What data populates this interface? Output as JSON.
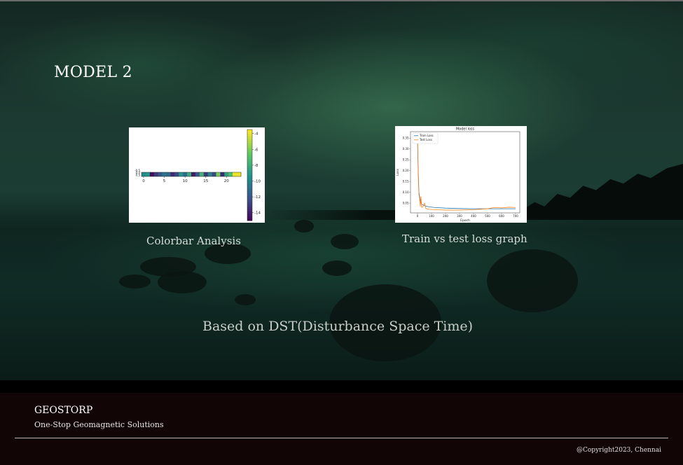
{
  "page": {
    "title": "MODEL 2",
    "subtitle": "Based on DST(Disturbance Space Time)"
  },
  "figures": {
    "left_caption": "Colorbar Analysis",
    "right_caption": "Train vs test loss graph"
  },
  "footer": {
    "brand": "GEOSTORP",
    "tagline": "One-Stop Geomagnetic Solutions",
    "copyright": "@Copyright2023, Chennai"
  },
  "colors": {
    "footer_bg": "#120506",
    "train_line": "#1f77b4",
    "test_line": "#ff7f0e"
  },
  "chart_data": [
    {
      "type": "heatmap",
      "title": "",
      "x_ticks": [
        "0",
        "5",
        "10",
        "15",
        "20"
      ],
      "y_ticks": [
        "-0.5",
        "0.0",
        "0.5"
      ],
      "colorbar_ticks": [
        "-4",
        "-6",
        "-8",
        "-10",
        "-12",
        "-14"
      ],
      "colorbar_range": [
        -15,
        -3.5
      ],
      "values": [
        -9.5,
        -9,
        -14.5,
        -13,
        -12,
        -10.5,
        -11,
        -13.5,
        -12.5,
        -9,
        -11,
        -8,
        -14,
        -12,
        -7.5,
        -13,
        -10,
        -12.5,
        -6,
        -13.5,
        -8.5,
        -7,
        -3.8,
        -3.8
      ],
      "colormap": "viridis"
    },
    {
      "type": "line",
      "title": "Model loss",
      "xlabel": "Epoch",
      "ylabel": "Loss",
      "x_ticks": [
        "0",
        "100",
        "200",
        "300",
        "400",
        "500",
        "600",
        "700"
      ],
      "y_ticks": [
        "0.05",
        "0.10",
        "0.15",
        "0.20",
        "0.25",
        "0.30",
        "0.35"
      ],
      "xlim": [
        -50,
        730
      ],
      "ylim": [
        0.005,
        0.38
      ],
      "legend": "top-left",
      "series": [
        {
          "name": "Train Loss",
          "x": [
            0,
            5,
            10,
            20,
            30,
            50,
            80,
            120,
            200,
            300,
            400,
            500,
            600,
            700
          ],
          "y": [
            0.35,
            0.2,
            0.1,
            0.06,
            0.045,
            0.038,
            0.033,
            0.03,
            0.027,
            0.025,
            0.024,
            0.024,
            0.024,
            0.024
          ]
        },
        {
          "name": "Test Loss",
          "x": [
            0,
            5,
            10,
            15,
            20,
            25,
            30,
            40,
            50,
            60,
            80,
            120,
            200,
            300,
            400,
            450,
            500,
            550,
            600,
            650,
            700
          ],
          "y": [
            0.35,
            0.18,
            0.09,
            0.07,
            0.035,
            0.08,
            0.03,
            0.035,
            0.05,
            0.025,
            0.022,
            0.02,
            0.018,
            0.018,
            0.02,
            0.022,
            0.024,
            0.03,
            0.028,
            0.031,
            0.03
          ]
        }
      ]
    }
  ]
}
